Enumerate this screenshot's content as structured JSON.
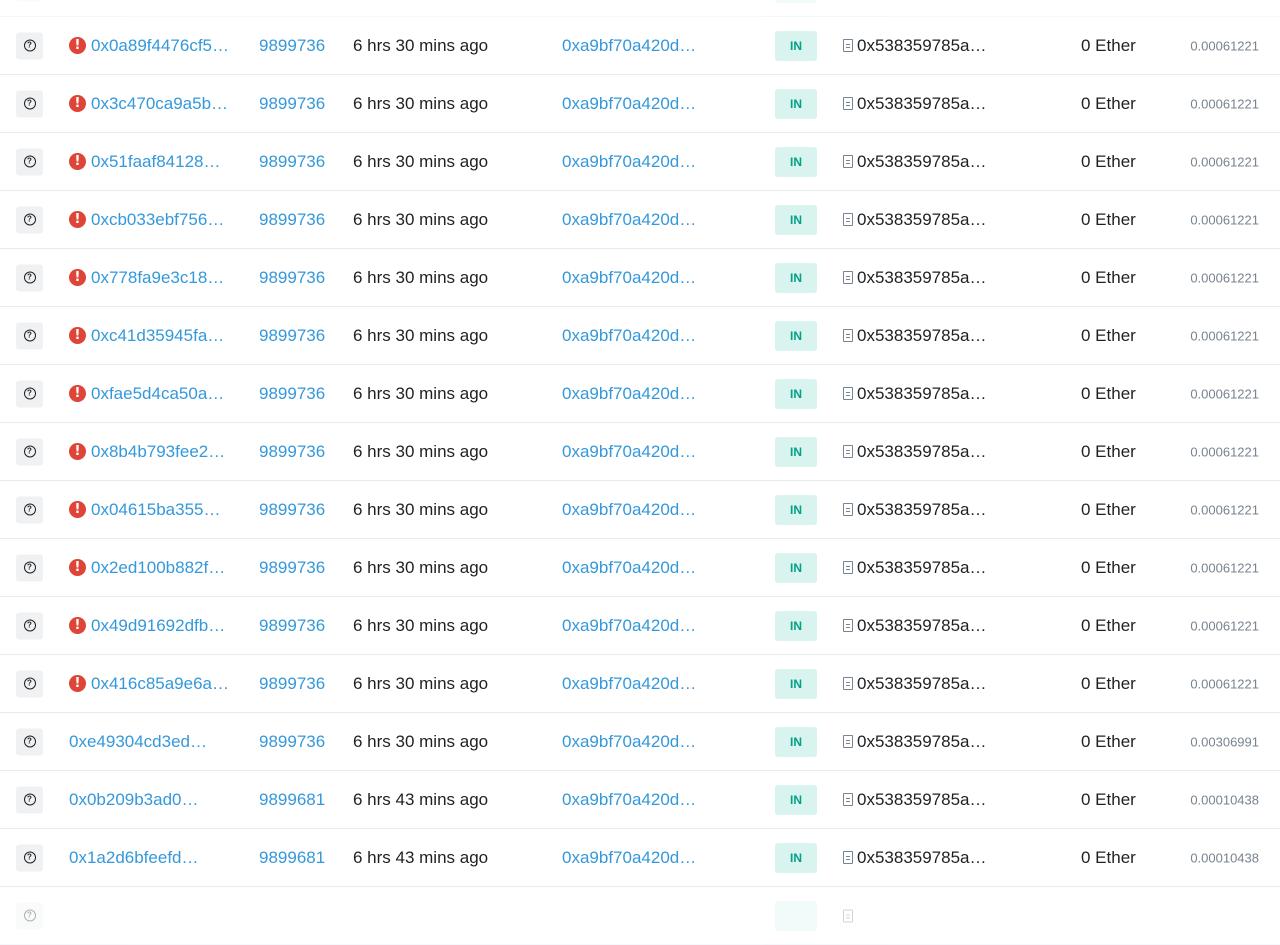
{
  "rows": [
    {
      "hash": "",
      "block": "",
      "age": "",
      "from": "",
      "direction": "",
      "to": "",
      "value": "",
      "fee": "",
      "error": false,
      "faded": true
    },
    {
      "hash": "0x0a89f4476cf5…",
      "block": "9899736",
      "age": "6 hrs 30 mins ago",
      "from": "0xa9bf70a420d…",
      "direction": "IN",
      "to": "0x538359785a…",
      "value": "0 Ether",
      "fee": "0.00061221",
      "error": true
    },
    {
      "hash": "0x3c470ca9a5b…",
      "block": "9899736",
      "age": "6 hrs 30 mins ago",
      "from": "0xa9bf70a420d…",
      "direction": "IN",
      "to": "0x538359785a…",
      "value": "0 Ether",
      "fee": "0.00061221",
      "error": true
    },
    {
      "hash": "0x51faaf84128…",
      "block": "9899736",
      "age": "6 hrs 30 mins ago",
      "from": "0xa9bf70a420d…",
      "direction": "IN",
      "to": "0x538359785a…",
      "value": "0 Ether",
      "fee": "0.00061221",
      "error": true
    },
    {
      "hash": "0xcb033ebf756…",
      "block": "9899736",
      "age": "6 hrs 30 mins ago",
      "from": "0xa9bf70a420d…",
      "direction": "IN",
      "to": "0x538359785a…",
      "value": "0 Ether",
      "fee": "0.00061221",
      "error": true
    },
    {
      "hash": "0x778fa9e3c18…",
      "block": "9899736",
      "age": "6 hrs 30 mins ago",
      "from": "0xa9bf70a420d…",
      "direction": "IN",
      "to": "0x538359785a…",
      "value": "0 Ether",
      "fee": "0.00061221",
      "error": true
    },
    {
      "hash": "0xc41d35945fa…",
      "block": "9899736",
      "age": "6 hrs 30 mins ago",
      "from": "0xa9bf70a420d…",
      "direction": "IN",
      "to": "0x538359785a…",
      "value": "0 Ether",
      "fee": "0.00061221",
      "error": true
    },
    {
      "hash": "0xfae5d4ca50a…",
      "block": "9899736",
      "age": "6 hrs 30 mins ago",
      "from": "0xa9bf70a420d…",
      "direction": "IN",
      "to": "0x538359785a…",
      "value": "0 Ether",
      "fee": "0.00061221",
      "error": true
    },
    {
      "hash": "0x8b4b793fee2…",
      "block": "9899736",
      "age": "6 hrs 30 mins ago",
      "from": "0xa9bf70a420d…",
      "direction": "IN",
      "to": "0x538359785a…",
      "value": "0 Ether",
      "fee": "0.00061221",
      "error": true
    },
    {
      "hash": "0x04615ba355…",
      "block": "9899736",
      "age": "6 hrs 30 mins ago",
      "from": "0xa9bf70a420d…",
      "direction": "IN",
      "to": "0x538359785a…",
      "value": "0 Ether",
      "fee": "0.00061221",
      "error": true
    },
    {
      "hash": "0x2ed100b882f…",
      "block": "9899736",
      "age": "6 hrs 30 mins ago",
      "from": "0xa9bf70a420d…",
      "direction": "IN",
      "to": "0x538359785a…",
      "value": "0 Ether",
      "fee": "0.00061221",
      "error": true
    },
    {
      "hash": "0x49d91692dfb…",
      "block": "9899736",
      "age": "6 hrs 30 mins ago",
      "from": "0xa9bf70a420d…",
      "direction": "IN",
      "to": "0x538359785a…",
      "value": "0 Ether",
      "fee": "0.00061221",
      "error": true
    },
    {
      "hash": "0x416c85a9e6a…",
      "block": "9899736",
      "age": "6 hrs 30 mins ago",
      "from": "0xa9bf70a420d…",
      "direction": "IN",
      "to": "0x538359785a…",
      "value": "0 Ether",
      "fee": "0.00061221",
      "error": true
    },
    {
      "hash": "0xe49304cd3ed…",
      "block": "9899736",
      "age": "6 hrs 30 mins ago",
      "from": "0xa9bf70a420d…",
      "direction": "IN",
      "to": "0x538359785a…",
      "value": "0 Ether",
      "fee": "0.00306991",
      "error": false
    },
    {
      "hash": "0x0b209b3ad0…",
      "block": "9899681",
      "age": "6 hrs 43 mins ago",
      "from": "0xa9bf70a420d…",
      "direction": "IN",
      "to": "0x538359785a…",
      "value": "0 Ether",
      "fee": "0.00010438",
      "error": false
    },
    {
      "hash": "0x1a2d6bfeefd…",
      "block": "9899681",
      "age": "6 hrs 43 mins ago",
      "from": "0xa9bf70a420d…",
      "direction": "IN",
      "to": "0x538359785a…",
      "value": "0 Ether",
      "fee": "0.00010438",
      "error": false
    },
    {
      "hash": "",
      "block": "",
      "age": "",
      "from": "",
      "direction": "",
      "to": "",
      "value": "",
      "fee": "",
      "error": false,
      "faded": true
    }
  ],
  "icons": {
    "details": "question-circle-icon",
    "error": "exclamation-circle-icon",
    "contract": "document-icon"
  },
  "colors": {
    "link": "#3498db",
    "error": "#de4437",
    "in_badge_bg": "#d9f4ef",
    "in_badge_text": "#00a186",
    "muted": "#77838f"
  }
}
